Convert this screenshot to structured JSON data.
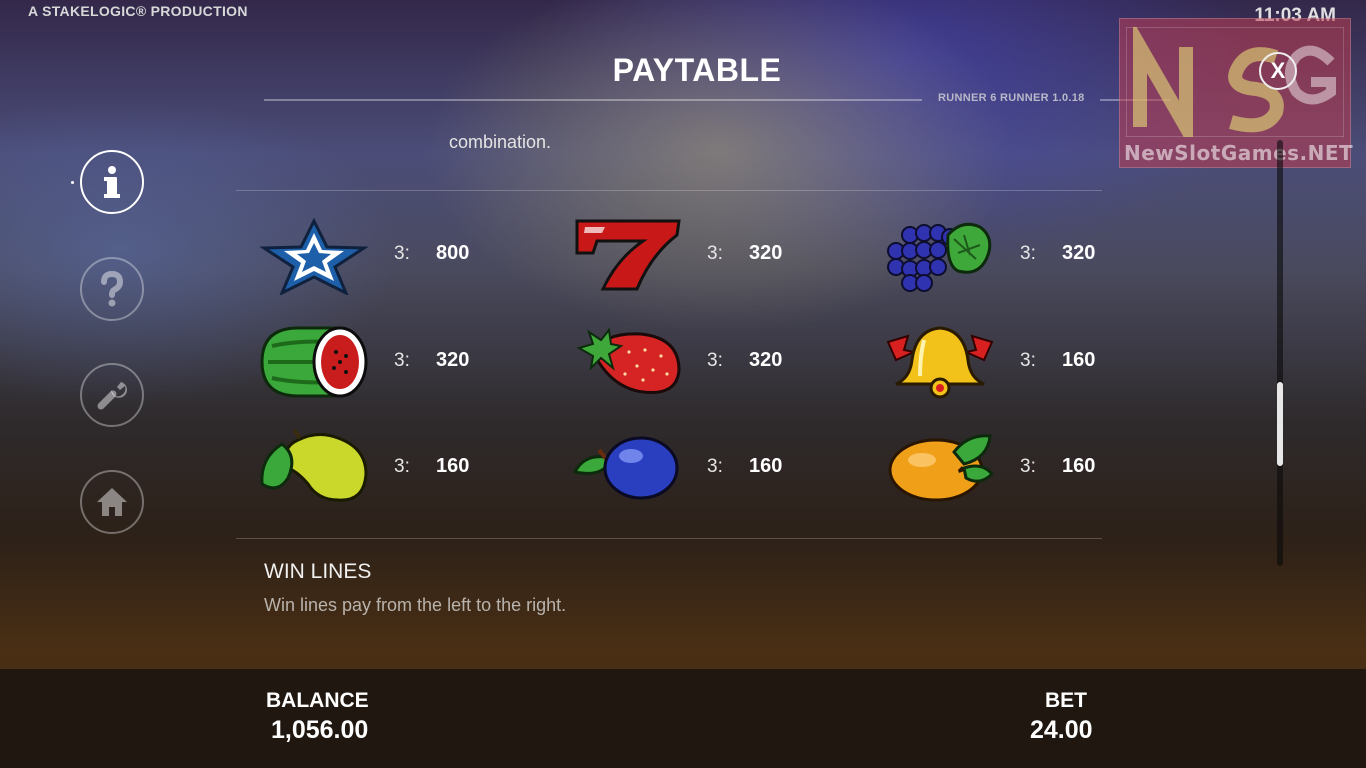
{
  "header": {
    "brand": "A STAKELOGIC® PRODUCTION",
    "clock": "11:03 AM",
    "title": "PAYTABLE",
    "version": "RUNNER 6 RUNNER 1.0.18",
    "close_label": "X"
  },
  "watermark": {
    "text": "NewSlotGames.NET"
  },
  "sidebar": {
    "items": [
      {
        "name": "info",
        "icon": "info-icon",
        "active": true
      },
      {
        "name": "help",
        "icon": "question-icon",
        "active": false
      },
      {
        "name": "settings",
        "icon": "wrench-icon",
        "active": false
      },
      {
        "name": "home",
        "icon": "home-icon",
        "active": false
      }
    ]
  },
  "content": {
    "intro_tail": "combination.",
    "paytable": [
      {
        "symbol": "star-icon",
        "mult": "3:",
        "payout": "800"
      },
      {
        "symbol": "seven-icon",
        "mult": "3:",
        "payout": "320"
      },
      {
        "symbol": "grapes-icon",
        "mult": "3:",
        "payout": "320"
      },
      {
        "symbol": "melon-icon",
        "mult": "3:",
        "payout": "320"
      },
      {
        "symbol": "strawberry-icon",
        "mult": "3:",
        "payout": "320"
      },
      {
        "symbol": "bell-icon",
        "mult": "3:",
        "payout": "160"
      },
      {
        "symbol": "pear-icon",
        "mult": "3:",
        "payout": "160"
      },
      {
        "symbol": "plum-icon",
        "mult": "3:",
        "payout": "160"
      },
      {
        "symbol": "orange-icon",
        "mult": "3:",
        "payout": "160"
      }
    ],
    "win_lines_title": "WIN LINES",
    "win_lines_text": "Win lines pay from the left to the right."
  },
  "scrollbar": {
    "position": 0.57
  },
  "footer": {
    "balance_label": "BALANCE",
    "balance_value": "1,056.00",
    "bet_label": "BET",
    "bet_value": "24.00"
  }
}
